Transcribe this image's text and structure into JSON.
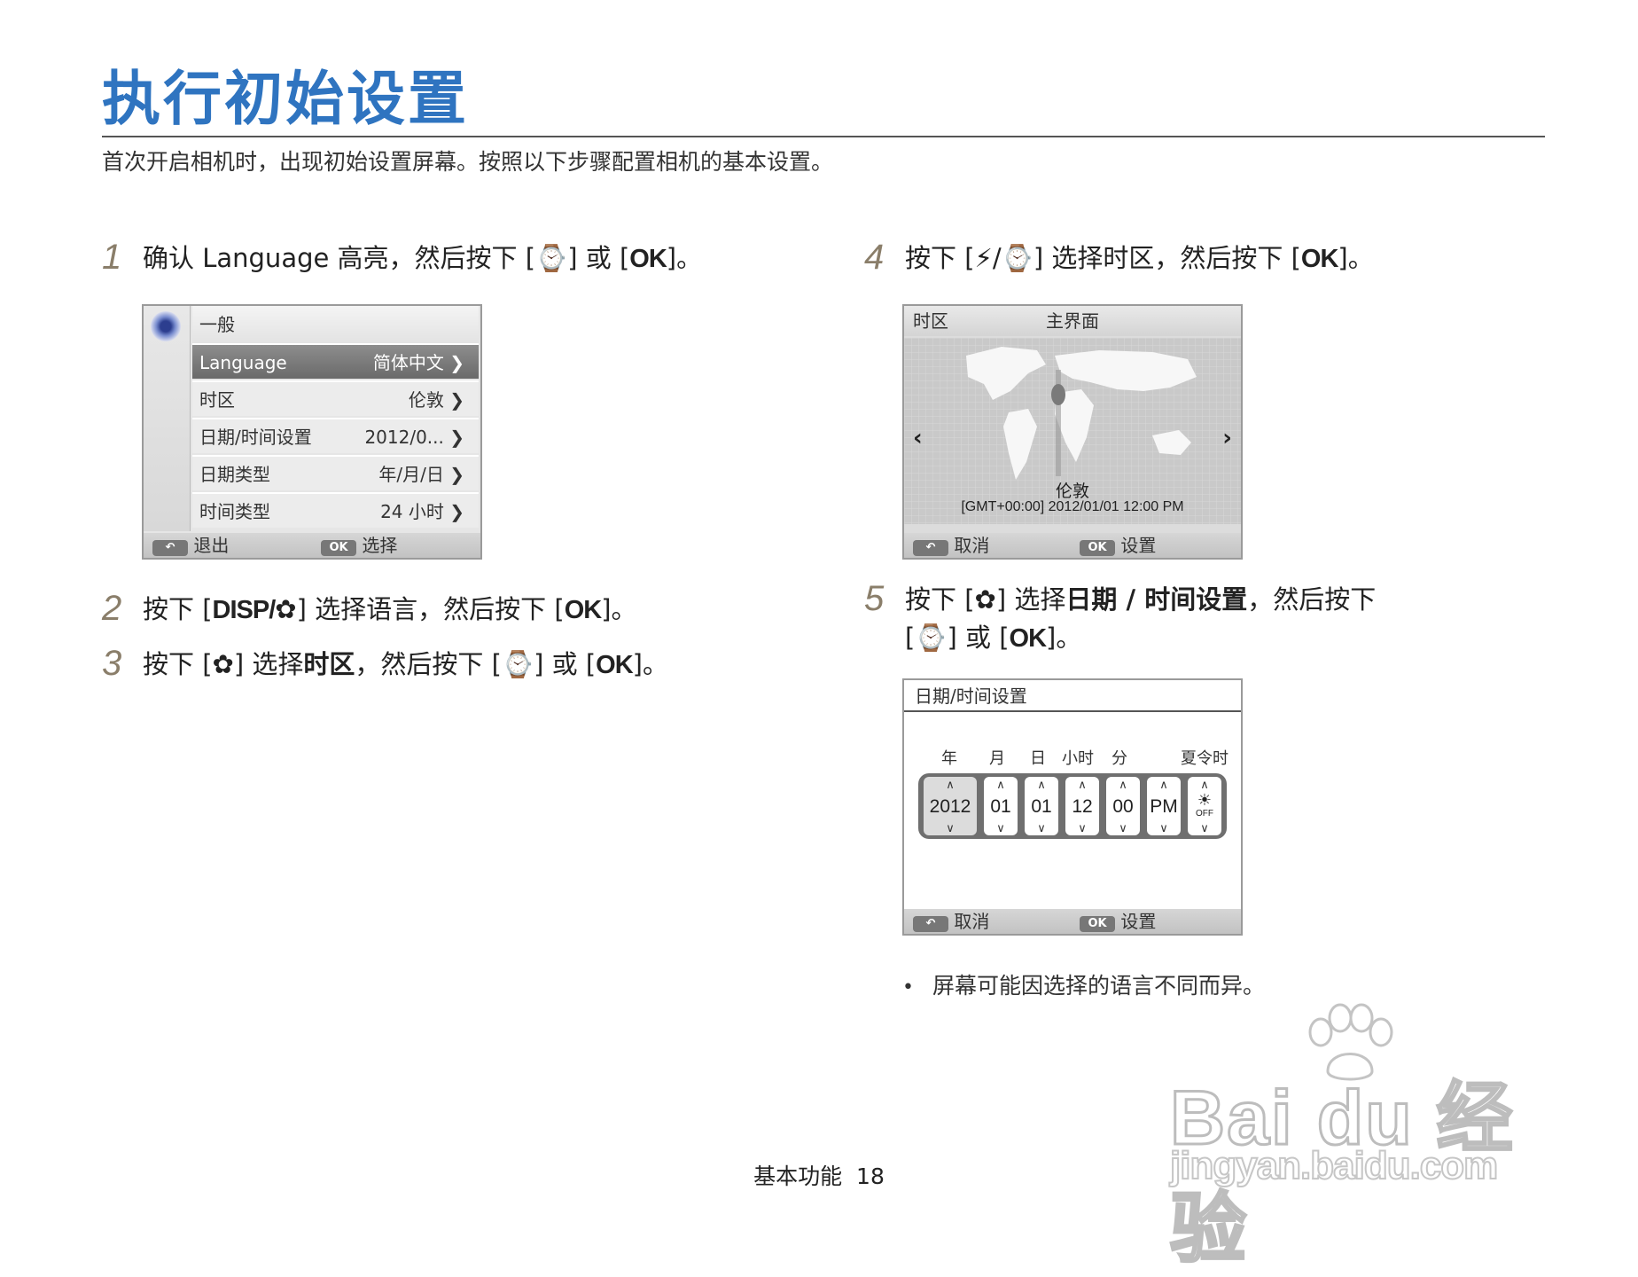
{
  "header": {
    "title": "执行初始设置",
    "subtitle": "首次开启相机时，出现初始设置屏幕。按照以下步骤配置相机的基本设置。"
  },
  "steps": [
    {
      "num": "1",
      "pre": "确认 Language 高亮，然后按下 [",
      "b1": "",
      "mid": "] 或 [",
      "key": "OK",
      "post": "]。"
    },
    {
      "num": "2",
      "pre": "按下 [",
      "key1": "DISP/",
      "mid": "] 选择语言，然后按下 [",
      "key": "OK",
      "post": "]。"
    },
    {
      "num": "3",
      "pre": "按下 [",
      "mid1": "] 选择",
      "bold": "时区",
      "mid": "，然后按下 [",
      "mid2": "] 或 [",
      "key": "OK",
      "post": "]。"
    },
    {
      "num": "4",
      "pre": "按下 [",
      "mid": "] 选择时区，然后按下 [",
      "key": "OK",
      "post": "]。"
    },
    {
      "num": "5",
      "pre": "按下 [",
      "mid1": "] 选择",
      "bold": "日期 / 时间设置",
      "mid": "，然后按下",
      "line2a": "[",
      "line2b": "] 或 [",
      "key": "OK",
      "post": "]。"
    }
  ],
  "screen1": {
    "header": "一般",
    "rows": [
      {
        "label": "Language",
        "value": "简体中文"
      },
      {
        "label": "时区",
        "value": "伦敦"
      },
      {
        "label": "日期/时间设置",
        "value": "2012/0..."
      },
      {
        "label": "日期类型",
        "value": "年/月/日"
      },
      {
        "label": "时间类型",
        "value": "24 小时"
      }
    ],
    "back_label": "退出",
    "ok_key": "OK",
    "ok_label": "选择"
  },
  "screen2": {
    "title_left": "时区",
    "title_center": "主界面",
    "city": "伦敦",
    "gmt": "[GMT+00:00] 2012/01/01  12:00 PM",
    "back_label": "取消",
    "ok_key": "OK",
    "ok_label": "设置"
  },
  "screen3": {
    "title": "日期/时间设置",
    "labels": {
      "year": "年",
      "month": "月",
      "day": "日",
      "hour": "小时",
      "minute": "分",
      "dst": "夏令时"
    },
    "values": {
      "year": "2012",
      "month": "01",
      "day": "01",
      "hour": "12",
      "minute": "00",
      "ampm": "PM",
      "dst_icon": "OFF"
    },
    "back_label": "取消",
    "ok_key": "OK",
    "ok_label": "设置"
  },
  "note": "屏幕可能因选择的语言不同而异。",
  "footer": {
    "section": "基本功能",
    "page": "18"
  },
  "watermark": {
    "brand": "Bai du 经验",
    "url": "jingyan.baidu.com"
  },
  "colors": {
    "title": "#2f74c0",
    "step_number": "#8a7e6a"
  }
}
